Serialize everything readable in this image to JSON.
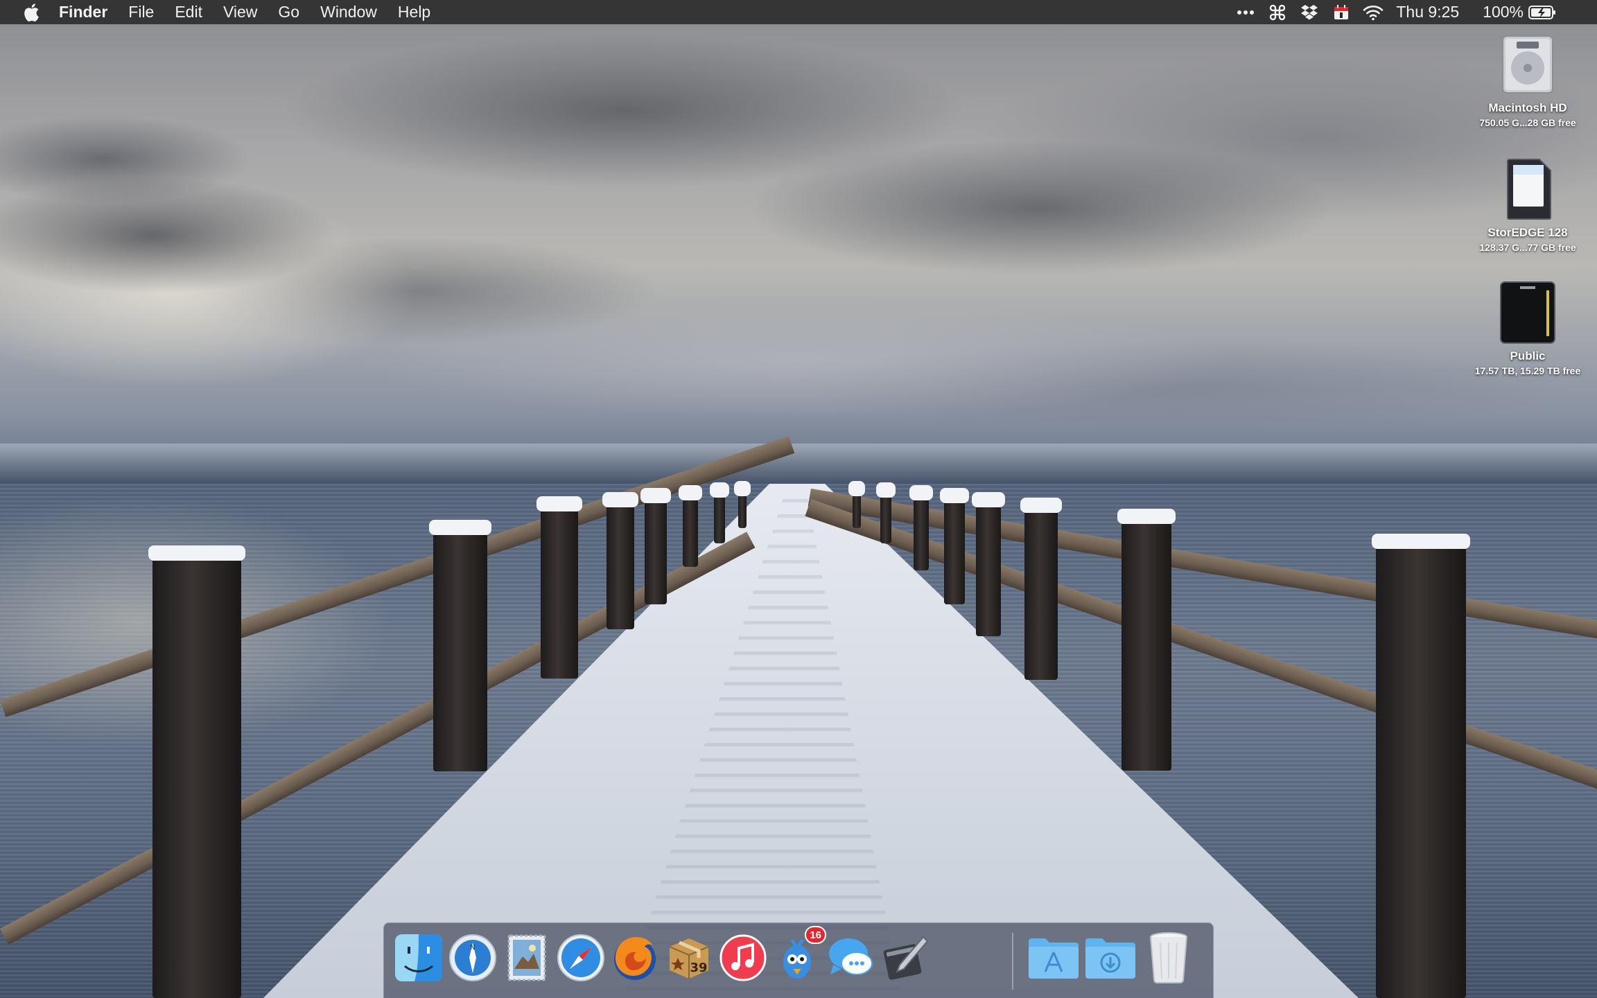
{
  "menubar": {
    "app_name": "Finder",
    "menus": [
      "File",
      "Edit",
      "View",
      "Go",
      "Window",
      "Help"
    ],
    "status_icons": [
      "overflow-dots-icon",
      "command-icon",
      "dropbox-icon",
      "calendar-icon",
      "wifi-icon"
    ],
    "clock": "Thu 9:25",
    "battery_percent": "100%",
    "battery_level": 1.0
  },
  "desktop_icons": [
    {
      "name": "Macintosh HD",
      "info": "750.05 G...28 GB free",
      "icon": "hard-drive-icon"
    },
    {
      "name": "StorEDGE 128",
      "info": "128.37 G...77 GB free",
      "icon": "sd-card-icon"
    },
    {
      "name": "Public",
      "info": "17.57 TB, 15.29 TB free",
      "icon": "nas-drive-icon"
    }
  ],
  "dock": {
    "apps": [
      {
        "name": "Finder",
        "icon": "finder-icon",
        "running": true
      },
      {
        "name": "Network Radar",
        "icon": "compass-globe-icon",
        "running": true
      },
      {
        "name": "Mail",
        "icon": "mail-stamp-icon",
        "running": true
      },
      {
        "name": "Safari",
        "icon": "safari-compass-icon",
        "running": true
      },
      {
        "name": "Firefox",
        "icon": "firefox-icon",
        "running": true
      },
      {
        "name": "Deliveries",
        "icon": "package-box-icon",
        "running": true,
        "badge_text": "39"
      },
      {
        "name": "iTunes",
        "icon": "music-note-icon",
        "running": true
      },
      {
        "name": "Tweetbot",
        "icon": "blue-bird-icon",
        "running": true,
        "badge": "16"
      },
      {
        "name": "Messages",
        "icon": "chat-bubbles-icon",
        "running": true
      },
      {
        "name": "Script Editor",
        "icon": "script-pen-icon",
        "running": false
      }
    ],
    "stacks": [
      {
        "name": "Applications",
        "icon": "applications-folder-icon"
      },
      {
        "name": "Downloads",
        "icon": "downloads-folder-icon"
      },
      {
        "name": "Trash",
        "icon": "trash-icon"
      }
    ]
  },
  "colors": {
    "menubar_bg": "#262628",
    "badge_red": "#e3282d",
    "folder_blue": "#5fb4ef"
  }
}
